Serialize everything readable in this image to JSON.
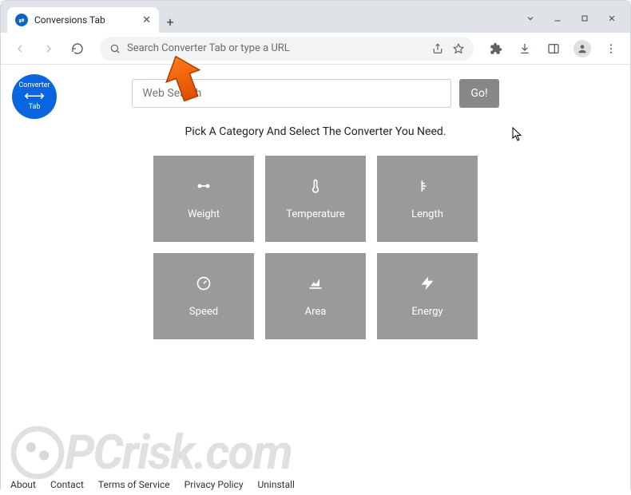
{
  "window": {
    "tab_title": "Conversions Tab"
  },
  "browser": {
    "omnibox_placeholder": "Search Converter Tab or type a URL"
  },
  "logo": {
    "line1": "Converter",
    "line2": "Tab"
  },
  "search": {
    "placeholder": "Web Search",
    "go_label": "Go!"
  },
  "prompt": "Pick A Category And Select The Converter You Need.",
  "cards": [
    {
      "label": "Weight",
      "icon": "weight"
    },
    {
      "label": "Temperature",
      "icon": "thermometer"
    },
    {
      "label": "Length",
      "icon": "ruler"
    },
    {
      "label": "Speed",
      "icon": "speed"
    },
    {
      "label": "Area",
      "icon": "area"
    },
    {
      "label": "Energy",
      "icon": "energy"
    }
  ],
  "footer": {
    "links": [
      "About",
      "Contact",
      "Terms of Service",
      "Privacy Policy",
      "Uninstall"
    ]
  },
  "watermark": "PCrisk.com"
}
